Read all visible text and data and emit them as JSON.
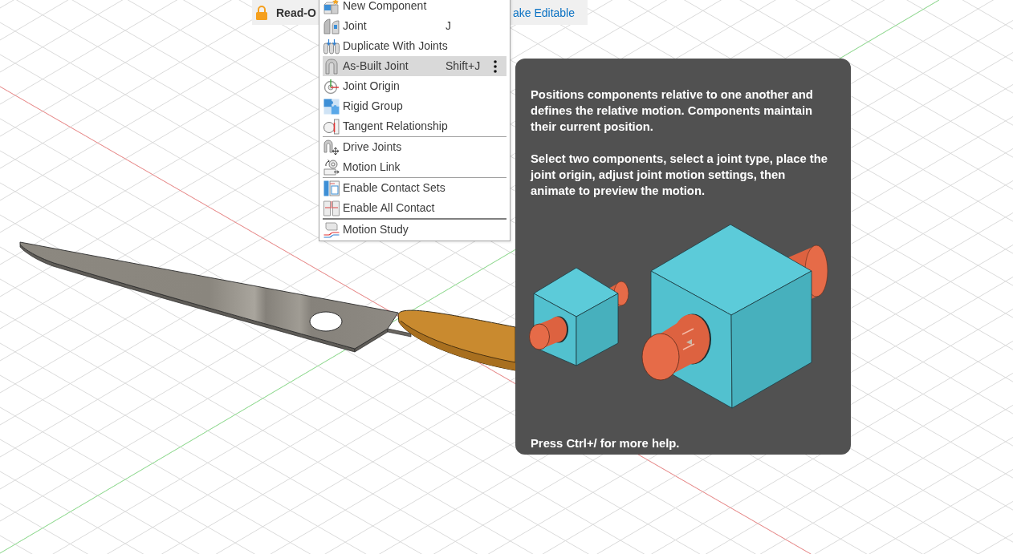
{
  "readonly_bar": {
    "label": "Read-O",
    "action": "ake Editable"
  },
  "menu": {
    "groups": [
      [
        {
          "label": "New Component",
          "selected": false
        },
        {
          "label": "Joint",
          "shortcut": "J",
          "selected": false
        },
        {
          "label": "Duplicate With Joints",
          "selected": false
        },
        {
          "label": "As-Built Joint",
          "shortcut": "Shift+J",
          "selected": true
        },
        {
          "label": "Joint Origin",
          "selected": false
        },
        {
          "label": "Rigid Group",
          "selected": false
        },
        {
          "label": "Tangent Relationship",
          "selected": false
        }
      ],
      [
        {
          "label": "Drive Joints",
          "selected": false
        },
        {
          "label": "Motion Link",
          "selected": false
        }
      ],
      [
        {
          "label": "Enable Contact Sets",
          "selected": false
        },
        {
          "label": "Enable All Contact",
          "selected": false
        }
      ],
      [
        {
          "label": "Motion Study",
          "selected": false
        }
      ]
    ]
  },
  "tooltip": {
    "paragraphs": [
      "Positions components relative to one another and defines the relative motion. Components maintain their current position.",
      "Select two components, select a joint type, place the joint origin, adjust joint motion settings, then animate to preview the motion."
    ],
    "footer": "Press Ctrl+/ for more help."
  }
}
